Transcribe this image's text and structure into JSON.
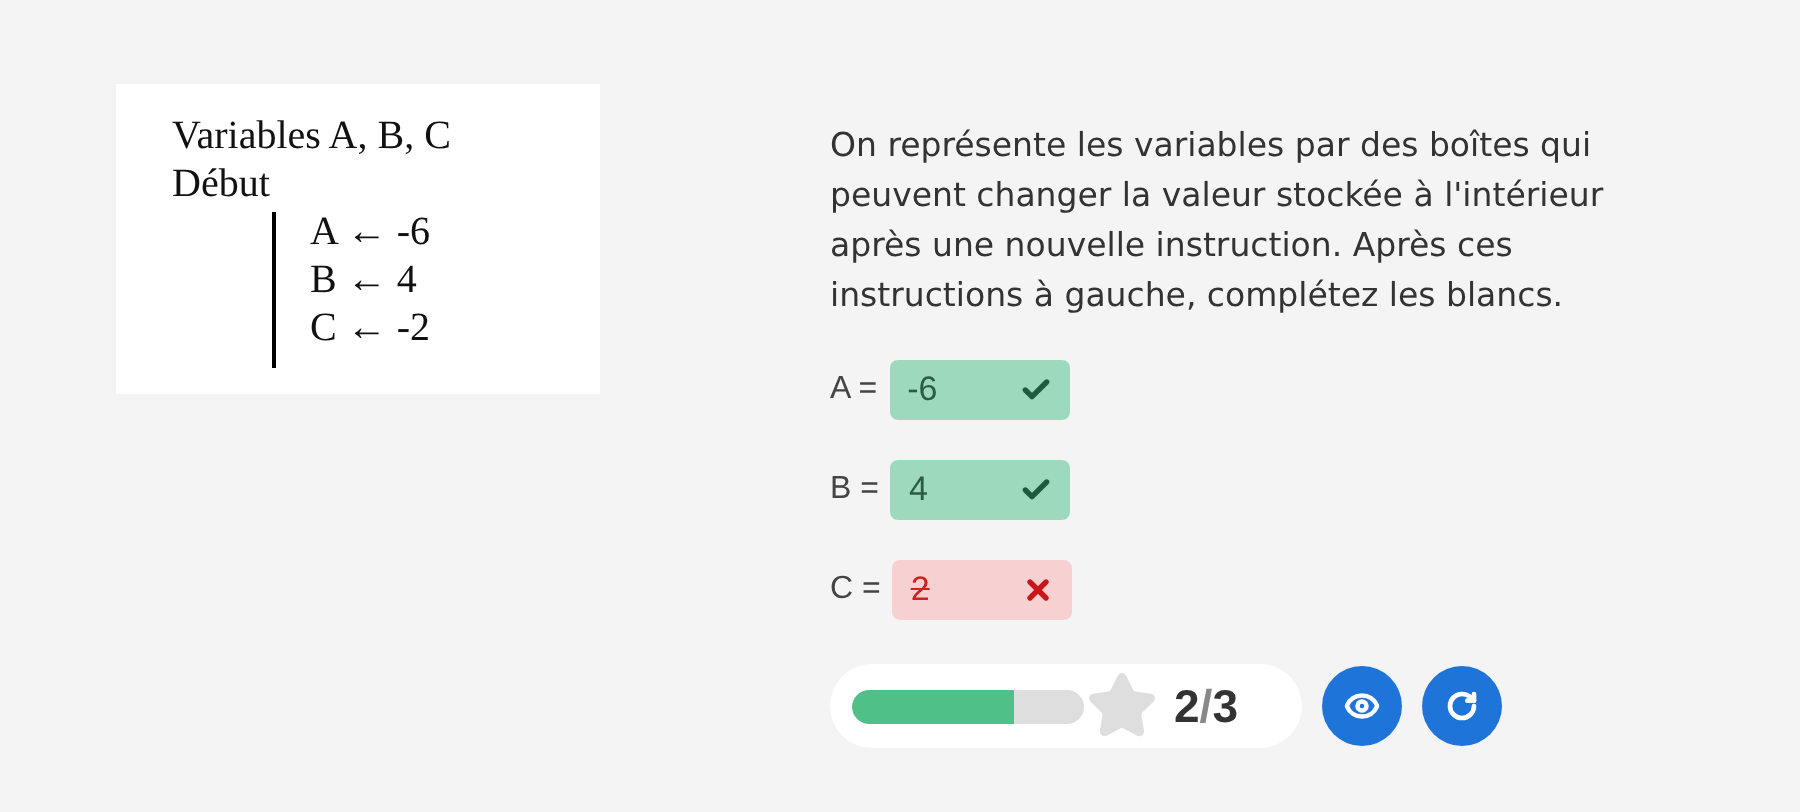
{
  "algorithm": {
    "lines": [
      {
        "kind": "header",
        "text": "Variables A, B, C"
      },
      {
        "kind": "header",
        "text": "Début"
      },
      {
        "kind": "step",
        "text": "A ← -6"
      },
      {
        "kind": "step",
        "text": "B ← 4"
      },
      {
        "kind": "step",
        "text": "C ← -2"
      }
    ]
  },
  "instructions": "On représente les variables par des boîtes qui peuvent changer la valeur stockée à l'intérieur après une nouvelle instruction. Après ces instructions à gauche, complétez les blancs.",
  "answers": [
    {
      "label": "A =",
      "value": "-6",
      "correct": true
    },
    {
      "label": "B =",
      "value": "4",
      "correct": true
    },
    {
      "label": "C =",
      "value": "2",
      "correct": false
    }
  ],
  "progress": {
    "level": 0.7,
    "score": "2",
    "separator": "/",
    "total": "3"
  }
}
